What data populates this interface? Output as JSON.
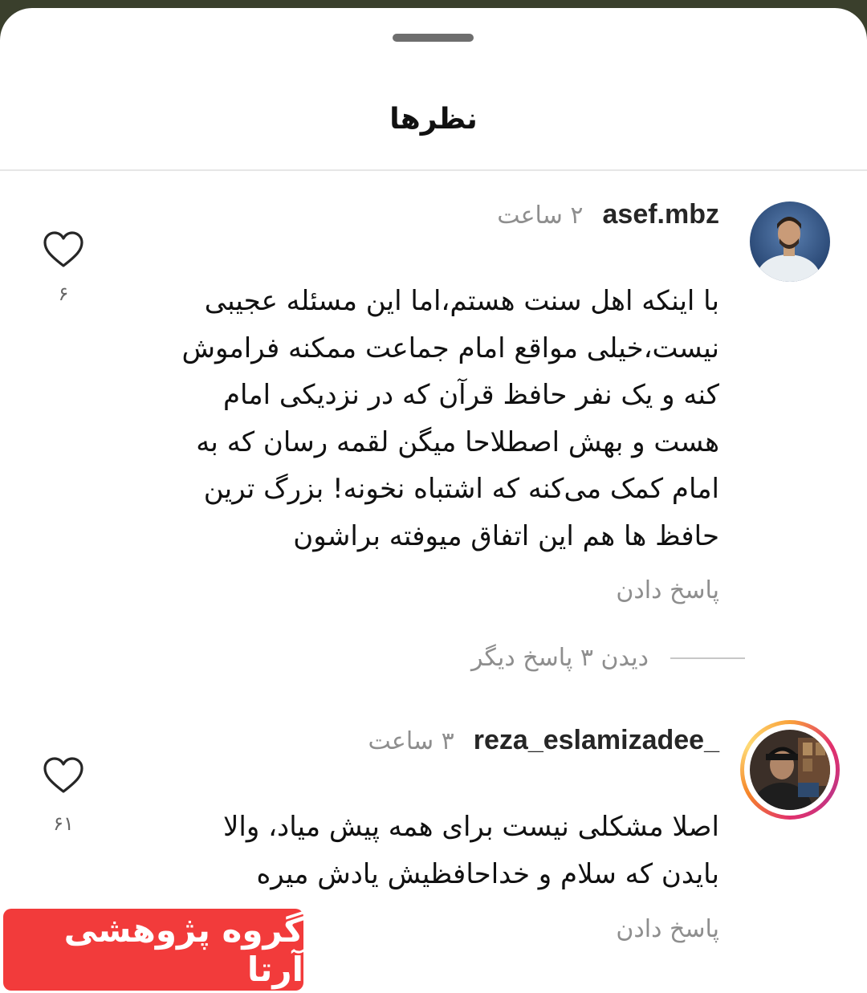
{
  "sheet": {
    "title": "نظرها"
  },
  "comments": [
    {
      "username": "asef.mbz",
      "time": "۲ ساعت",
      "text": "با اینکه اهل سنت هستم،اما این مسئله عجیبی\nنیست،خیلی مواقع امام جماعت ممکنه فراموش\nکنه و یک نفر حافظ قرآن که در نزدیکی امام\nهست و بهش اصطلاحا میگن لقمه رسان که به\nامام کمک می‌کنه که اشتباه نخونه! بزرگ ترین\nحافظ ها هم این اتفاق میوفته براشون",
      "reply_label": "پاسخ دادن",
      "view_replies": "دیدن ۳ پاسخ دیگر",
      "like_count": "۶",
      "icon": "heart-icon",
      "has_story_ring": false
    },
    {
      "username": "_reza_eslamizadee",
      "time": "۳ ساعت",
      "text": "اصلا مشکلی نیست برای همه پیش میاد، والا\nبایدن که سلام و خداحافظیش یادش میره",
      "reply_label": "پاسخ دادن",
      "like_count": "۶۱",
      "icon": "heart-icon",
      "has_story_ring": true
    }
  ],
  "watermark": {
    "text": "گروه پژوهشی آرتا"
  },
  "colors": {
    "story_ring": "#e1306c",
    "secondary_text": "#8e8e8e",
    "watermark_bg": "#f23b3b"
  }
}
